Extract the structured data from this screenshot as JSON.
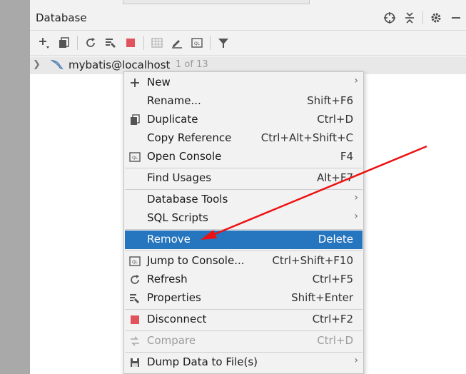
{
  "panel": {
    "title": "Database",
    "header_icons": [
      "crosshair-icon",
      "collapse-icon",
      "gear-icon",
      "minimize-icon"
    ]
  },
  "toolbar": {
    "buttons": [
      "add-icon",
      "duplicate-icon",
      "refresh-icon",
      "properties-icon",
      "stop-icon",
      "table-icon",
      "edit-icon",
      "console-icon",
      "filter-icon"
    ]
  },
  "tree": {
    "datasource": "mybatis@localhost",
    "count": "1 of 13"
  },
  "menu": {
    "items": [
      {
        "label": "New",
        "shortcut": "",
        "submenu": false,
        "icon": "plus-icon"
      },
      {
        "label": "Rename...",
        "shortcut": "Shift+F6",
        "submenu": false,
        "icon": ""
      },
      {
        "label": "Duplicate",
        "shortcut": "Ctrl+D",
        "submenu": false,
        "icon": "duplicate-icon"
      },
      {
        "label": "Copy Reference",
        "shortcut": "Ctrl+Alt+Shift+C",
        "submenu": false,
        "icon": ""
      },
      {
        "label": "Open Console",
        "shortcut": "F4",
        "submenu": false,
        "icon": "console-icon"
      },
      {
        "label": "Find Usages",
        "shortcut": "Alt+F7",
        "submenu": false,
        "icon": ""
      },
      {
        "label": "Database Tools",
        "shortcut": "",
        "submenu": true,
        "icon": ""
      },
      {
        "label": "SQL Scripts",
        "shortcut": "",
        "submenu": true,
        "icon": ""
      },
      {
        "label": "Remove",
        "shortcut": "Delete",
        "submenu": false,
        "icon": "",
        "selected": true
      },
      {
        "label": "Jump to Console...",
        "shortcut": "Ctrl+Shift+F10",
        "submenu": false,
        "icon": "console-icon"
      },
      {
        "label": "Refresh",
        "shortcut": "Ctrl+F5",
        "submenu": false,
        "icon": "refresh-icon"
      },
      {
        "label": "Properties",
        "shortcut": "Shift+Enter",
        "submenu": false,
        "icon": "properties-icon"
      },
      {
        "label": "Disconnect",
        "shortcut": "Ctrl+F2",
        "submenu": false,
        "icon": "stop-icon"
      },
      {
        "label": "Compare",
        "shortcut": "Ctrl+D",
        "submenu": false,
        "icon": "compare-icon",
        "disabled": true
      },
      {
        "label": "Dump Data to File(s)",
        "shortcut": "",
        "submenu": true,
        "icon": "save-icon"
      }
    ]
  },
  "colors": {
    "selection": "#2675bf",
    "stop": "#e0535d",
    "annotation_arrow": "#ee1111"
  }
}
